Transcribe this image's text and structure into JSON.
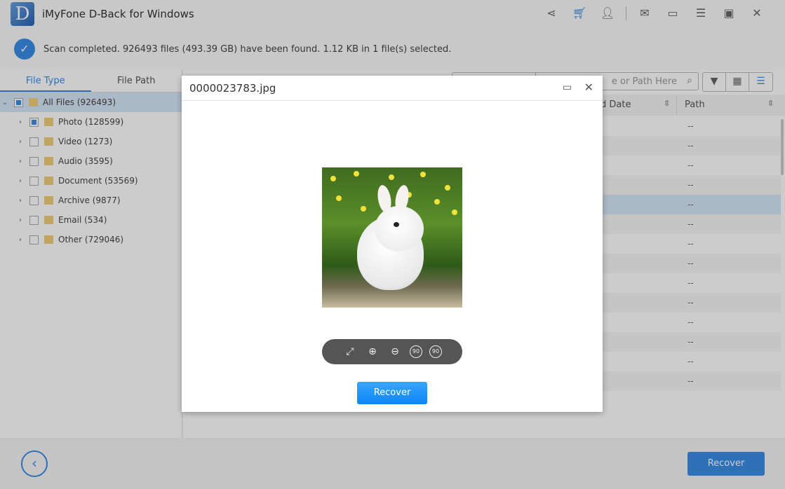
{
  "app": {
    "title": "iMyFone D-Back for Windows",
    "logo_letter": "D",
    "title_icons": [
      "share-icon",
      "cart-icon",
      "user-icon",
      "mail-icon",
      "feedback-icon",
      "menu-icon",
      "maximize-icon",
      "close-icon"
    ]
  },
  "status": {
    "text": "Scan completed. 926493 files (493.39 GB) have been found. 1.12 KB in 1 file(s) selected."
  },
  "sidebar": {
    "tabs": [
      "File Type",
      "File Path"
    ],
    "root": "All Files (926493)",
    "items": [
      "Photo (128599)",
      "Video (1273)",
      "Audio (3595)",
      "Document (53569)",
      "Archive (9877)",
      "Email (534)",
      "Other (729046)"
    ]
  },
  "main": {
    "search_placeholder": "e or Path Here",
    "columns": [
      "d Date",
      "Path"
    ],
    "rows": [
      "--",
      "--",
      "--",
      "--",
      "--",
      "--",
      "--",
      "--",
      "--",
      "--",
      "--",
      "--",
      "--",
      "--"
    ],
    "selected_row": 4
  },
  "preview": {
    "filename": "0000023783.jpg",
    "tools": [
      "fit-screen",
      "zoom-in",
      "zoom-out",
      "rotate-left-90",
      "rotate-right-90"
    ],
    "rotate_label": "90",
    "recover": "Recover"
  },
  "footer": {
    "recover": "Recover"
  },
  "colors": {
    "accent": "#3a8ee6",
    "overlay": "rgba(0,0,0,0.2)"
  }
}
